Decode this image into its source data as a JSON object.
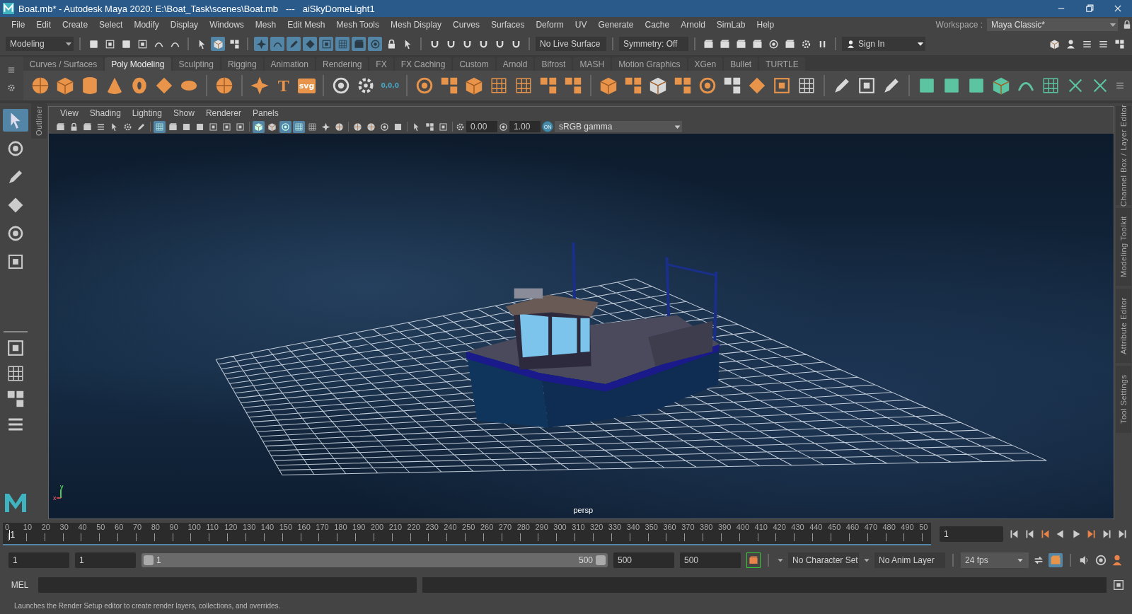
{
  "window": {
    "title": "Boat.mb* - Autodesk Maya 2020: E:\\Boat_Task\\scenes\\Boat.mb   ---   aiSkyDomeLight1"
  },
  "menu_bar": [
    "File",
    "Edit",
    "Create",
    "Select",
    "Modify",
    "Display",
    "Windows",
    "Mesh",
    "Edit Mesh",
    "Mesh Tools",
    "Mesh Display",
    "Curves",
    "Surfaces",
    "Deform",
    "UV",
    "Generate",
    "Cache",
    "Arnold",
    "SimLab",
    "Help"
  ],
  "workspace": {
    "label": "Workspace :",
    "value": "Maya Classic*"
  },
  "status_line": {
    "menu_set": "Modeling",
    "live_surface": "No Live Surface",
    "symmetry": "Symmetry: Off",
    "sign_in": "Sign In",
    "select_modes": [
      {
        "selected": false
      },
      {
        "selected": true
      },
      {
        "selected": false
      }
    ],
    "mask_buttons": [
      {
        "selected": true
      },
      {
        "selected": true
      },
      {
        "selected": true
      },
      {
        "selected": true
      },
      {
        "selected": true
      },
      {
        "selected": true
      },
      {
        "selected": true
      },
      {
        "selected": true
      },
      {
        "selected": false
      },
      {
        "selected": false
      }
    ]
  },
  "shelf": {
    "tabs": [
      {
        "label": "Curves / Surfaces",
        "selected": false
      },
      {
        "label": "Poly Modeling",
        "selected": true
      },
      {
        "label": "Sculpting",
        "selected": false
      },
      {
        "label": "Rigging",
        "selected": false
      },
      {
        "label": "Animation",
        "selected": false
      },
      {
        "label": "Rendering",
        "selected": false
      },
      {
        "label": "FX",
        "selected": false
      },
      {
        "label": "FX Caching",
        "selected": false
      },
      {
        "label": "Custom",
        "selected": false
      },
      {
        "label": "Arnold",
        "selected": false
      },
      {
        "label": "Bifrost",
        "selected": false
      },
      {
        "label": "MASH",
        "selected": false
      },
      {
        "label": "Motion Graphics",
        "selected": false
      },
      {
        "label": "XGen",
        "selected": false
      },
      {
        "label": "Bullet",
        "selected": false
      },
      {
        "label": "TURTLE",
        "selected": false
      }
    ],
    "type_icon": "T",
    "svg_icon": "svg",
    "zero_icon": "0,0,0"
  },
  "tools": [
    {
      "selected": true
    },
    {
      "selected": false
    },
    {
      "selected": false
    },
    {
      "selected": false
    },
    {
      "selected": false
    },
    {
      "selected": false
    }
  ],
  "outliner_tab": "Outliner",
  "side_tabs": [
    "Channel Box / Layer Editor",
    "Modeling Toolkit",
    "Attribute Editor",
    "Tool Settings"
  ],
  "viewport": {
    "menus": [
      "View",
      "Shading",
      "Lighting",
      "Show",
      "Renderer",
      "Panels"
    ],
    "icon_bar": [
      {
        "selected": false
      },
      {
        "selected": false
      },
      {
        "selected": false
      },
      {
        "selected": false
      },
      {
        "selected": false
      },
      {
        "selected": false
      },
      {
        "selected": false
      },
      {
        "selected": true
      },
      {
        "selected": false
      },
      {
        "selected": false
      },
      {
        "selected": false
      },
      {
        "selected": false
      },
      {
        "selected": false
      },
      {
        "selected": false
      },
      {
        "selected": true
      },
      {
        "selected": false
      },
      {
        "selected": true
      },
      {
        "selected": true
      },
      {
        "selected": false
      },
      {
        "selected": false
      },
      {
        "selected": false
      },
      {
        "selected": false
      },
      {
        "selected": false
      },
      {
        "selected": false
      },
      {
        "selected": false
      },
      {
        "selected": false
      },
      {
        "selected": false
      },
      {
        "selected": false
      }
    ],
    "exposure": "0.00",
    "gamma": "1.00",
    "color_management": "ON",
    "color_space": "sRGB gamma",
    "camera": "persp",
    "axes": [
      "y",
      "x"
    ]
  },
  "time_slider": {
    "ticks": [
      "0",
      "10",
      "20",
      "30",
      "40",
      "50",
      "60",
      "70",
      "80",
      "90",
      "100",
      "110",
      "120",
      "130",
      "140",
      "150",
      "160",
      "170",
      "180",
      "190",
      "200",
      "210",
      "220",
      "230",
      "240",
      "250",
      "260",
      "270",
      "280",
      "290",
      "300",
      "310",
      "320",
      "330",
      "340",
      "350",
      "360",
      "370",
      "380",
      "390",
      "400",
      "410",
      "420",
      "430",
      "440",
      "450",
      "460",
      "470",
      "480",
      "490",
      "50"
    ],
    "current_frame": "1",
    "level": 0.002,
    "current_field": "1"
  },
  "range_slider": {
    "start": "1",
    "playback_start": "1",
    "bar_start": "1",
    "bar_end": "500",
    "level": 1,
    "playback_end": "500",
    "end": "500"
  },
  "character_set": "No Character Set",
  "anim_layer": "No Anim Layer",
  "fps": "24 fps",
  "command_line": {
    "language": "MEL"
  },
  "help_line": "Launches the Render Setup editor to create render layers, collections, and overrides."
}
